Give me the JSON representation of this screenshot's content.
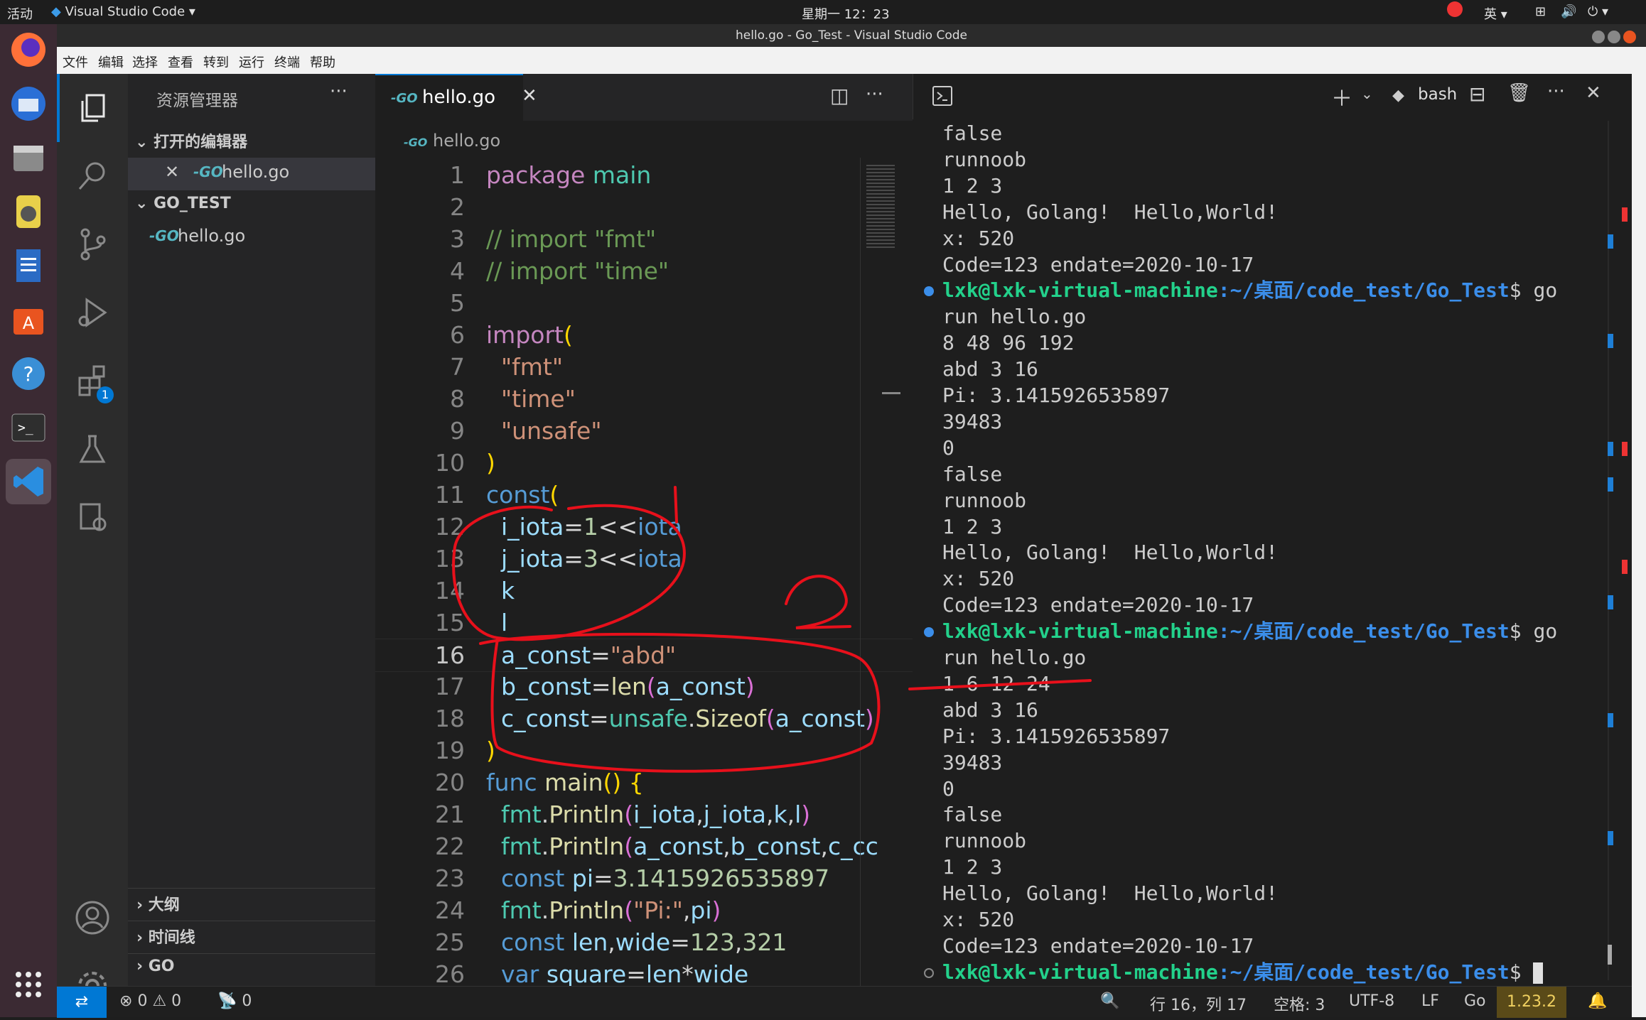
{
  "topbar": {
    "activities": "活动",
    "app": "Visual Studio Code",
    "clock": "星期一 12：23",
    "lang": "英"
  },
  "window": {
    "title": "hello.go - Go_Test - Visual Studio Code"
  },
  "menu": [
    "文件",
    "编辑",
    "选择",
    "查看",
    "转到",
    "运行",
    "终端",
    "帮助"
  ],
  "activity": {
    "extensions_badge": "1"
  },
  "sidebar": {
    "title": "资源管理器",
    "open_editors": "打开的编辑器",
    "open_file": "hello.go",
    "folder": "GO_TEST",
    "folder_file": "hello.go",
    "outline": "大纲",
    "timeline": "时间线",
    "go": "GO"
  },
  "editor": {
    "tab": "hello.go",
    "breadcrumb": "hello.go",
    "current_line": 16
  },
  "terminal": {
    "shell": "bash",
    "lines": [
      "false",
      "runnoob",
      "1 2 3",
      "Hello, Golang!  Hello,World!",
      "x: 520",
      "Code=123 endate=2020-10-17",
      "lxk@lxk-virtual-machine:~/桌面/code_test/Go_Test$ go",
      "run hello.go",
      "8 48 96 192",
      "abd 3 16",
      "Pi: 3.1415926535897",
      "39483",
      "0",
      "false",
      "runnoob",
      "1 2 3",
      "Hello, Golang!  Hello,World!",
      "x: 520",
      "Code=123 endate=2020-10-17",
      "lxk@lxk-virtual-machine:~/桌面/code_test/Go_Test$ go",
      "run hello.go",
      "1 6 12 24",
      "abd 3 16",
      "Pi: 3.1415926535897",
      "39483",
      "0",
      "false",
      "runnoob",
      "1 2 3",
      "Hello, Golang!  Hello,World!",
      "x: 520",
      "Code=123 endate=2020-10-17",
      "lxk@lxk-virtual-machine:~/桌面/code_test/Go_Test$"
    ],
    "prompt_user": "lxk@lxk-virtual-machine",
    "prompt_path": ":~/桌面/code_test/Go_Test",
    "prompt_tail": "$ go",
    "prompt_tail_last": "$"
  },
  "status": {
    "errors": "0",
    "warnings": "0",
    "ports": "0",
    "position": "行 16，列 17",
    "spaces": "空格: 3",
    "encoding": "UTF-8",
    "eol": "LF",
    "language": "Go",
    "go_version": "1.23.2"
  },
  "annotation": "2",
  "colors": {
    "accent": "#0078d4",
    "annotation_red": "#e8101b",
    "prompt_green": "#23d18b",
    "prompt_blue": "#3b8eea"
  }
}
